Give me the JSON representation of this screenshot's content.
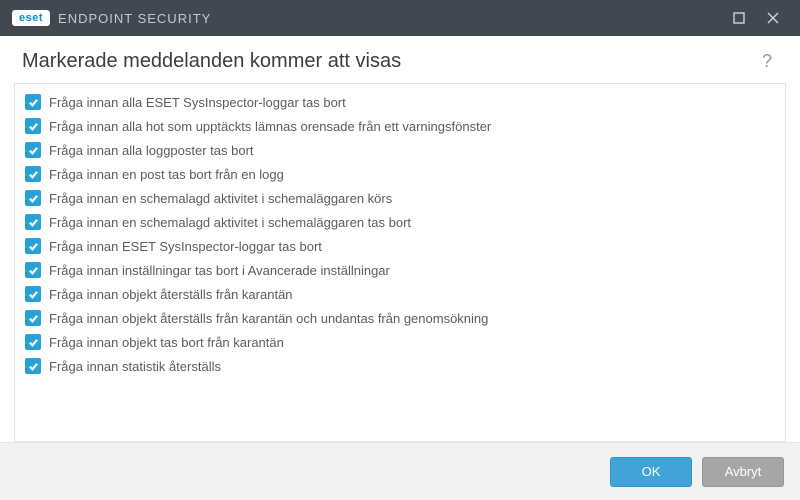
{
  "titlebar": {
    "brand_badge": "eset",
    "brand_text": "ENDPOINT SECURITY"
  },
  "header": {
    "title": "Markerade meddelanden kommer att visas",
    "help_symbol": "?"
  },
  "list": {
    "items": [
      {
        "checked": true,
        "label": "Fråga innan alla ESET SysInspector-loggar tas bort"
      },
      {
        "checked": true,
        "label": "Fråga innan alla hot som upptäckts lämnas orensade från ett varningsfönster"
      },
      {
        "checked": true,
        "label": "Fråga innan alla loggposter tas bort"
      },
      {
        "checked": true,
        "label": "Fråga innan en post tas bort från en logg"
      },
      {
        "checked": true,
        "label": "Fråga innan en schemalagd aktivitet i schemaläggaren körs"
      },
      {
        "checked": true,
        "label": "Fråga innan en schemalagd aktivitet i schemaläggaren tas bort"
      },
      {
        "checked": true,
        "label": "Fråga innan ESET SysInspector-loggar tas bort"
      },
      {
        "checked": true,
        "label": "Fråga innan inställningar tas bort i Avancerade inställningar"
      },
      {
        "checked": true,
        "label": "Fråga innan objekt återställs från karantän"
      },
      {
        "checked": true,
        "label": "Fråga innan objekt återställs från karantän och undantas från genomsökning"
      },
      {
        "checked": true,
        "label": "Fråga innan objekt tas bort från karantän"
      },
      {
        "checked": true,
        "label": "Fråga innan statistik återställs"
      }
    ]
  },
  "footer": {
    "ok_label": "OK",
    "cancel_label": "Avbryt"
  },
  "colors": {
    "accent": "#27a1da",
    "titlebar": "#414852"
  }
}
